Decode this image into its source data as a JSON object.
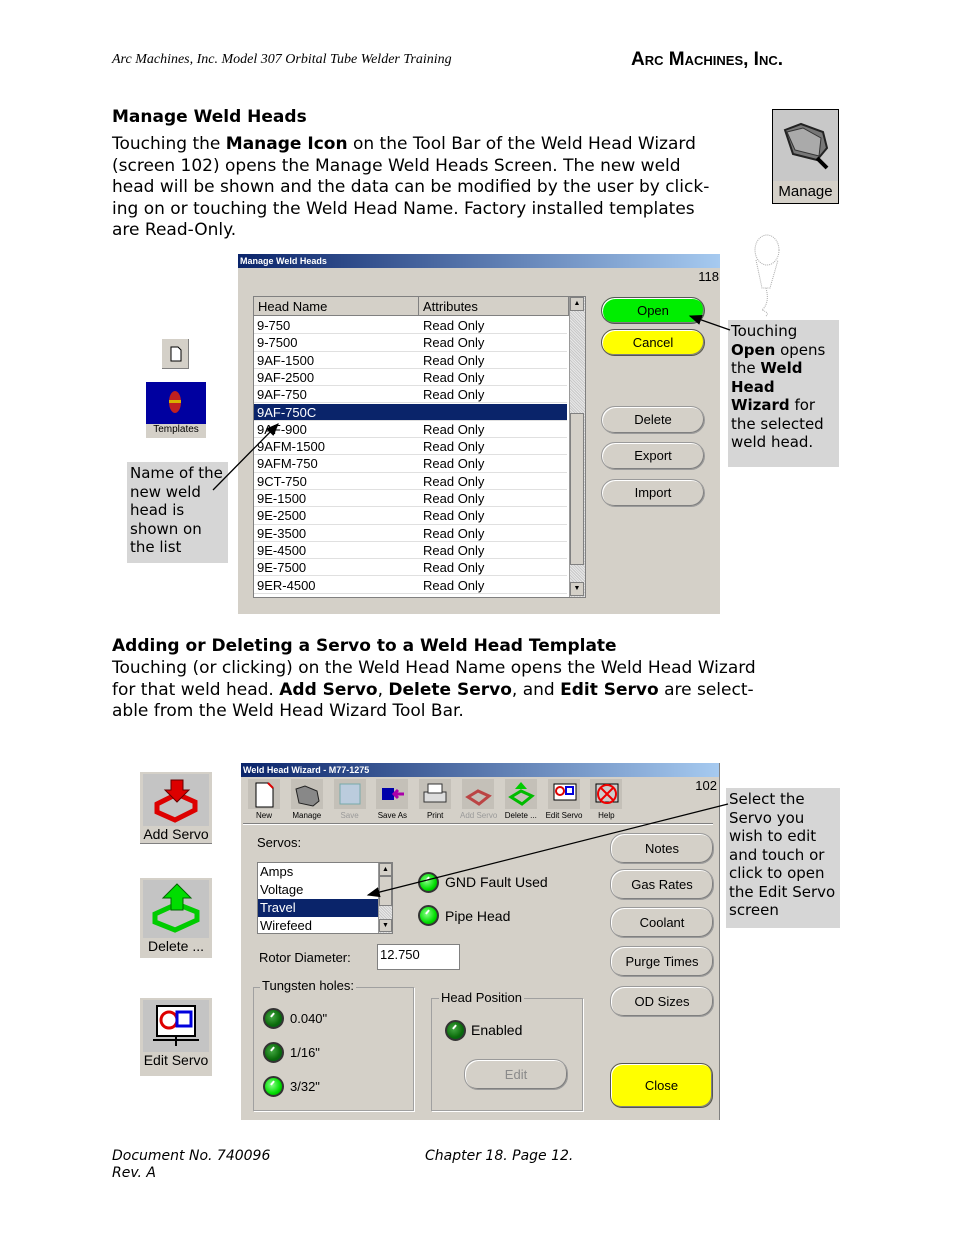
{
  "header": {
    "left": "Arc Machines, Inc. Model 307 Orbital  Tube Welder Training",
    "right": "Arc Machines, Inc."
  },
  "section1": {
    "title": "Manage Weld Heads",
    "p_pre": "Touching the ",
    "p_bold": "Manage Icon",
    "p_line1_rest": " on the Tool Bar of the Weld Head Wizard",
    "p_line2": "(screen 102) opens the Manage Weld Heads Screen. The new weld",
    "p_line3": "head will be shown and the data can be modified by the user by click-",
    "p_line4": "ing on or touching the Weld Head Name. Factory installed templates",
    "p_line5": "are Read-Only.",
    "manage_icon_label": "Manage"
  },
  "manage_dialog": {
    "title": "Manage Weld Heads",
    "screen_number": "118",
    "columns": [
      "Head Name",
      "Attributes"
    ],
    "rows": [
      {
        "name": "9-750",
        "attr": "Read Only"
      },
      {
        "name": "9-7500",
        "attr": "Read Only"
      },
      {
        "name": "9AF-1500",
        "attr": "Read Only"
      },
      {
        "name": "9AF-2500",
        "attr": "Read Only"
      },
      {
        "name": "9AF-750",
        "attr": "Read Only"
      },
      {
        "name": "9AF-750C",
        "attr": ""
      },
      {
        "name": "9AF-900",
        "attr": "Read Only"
      },
      {
        "name": "9AFM-1500",
        "attr": "Read Only"
      },
      {
        "name": "9AFM-750",
        "attr": "Read Only"
      },
      {
        "name": "9CT-750",
        "attr": "Read Only"
      },
      {
        "name": "9E-1500",
        "attr": "Read Only"
      },
      {
        "name": "9E-2500",
        "attr": "Read Only"
      },
      {
        "name": "9E-3500",
        "attr": "Read Only"
      },
      {
        "name": "9E-4500",
        "attr": "Read Only"
      },
      {
        "name": "9E-7500",
        "attr": "Read Only"
      },
      {
        "name": "9ER-4500",
        "attr": "Read Only"
      }
    ],
    "selected_row": "9AF-750C",
    "buttons": {
      "open": "Open",
      "cancel": "Cancel",
      "delete": "Delete",
      "export": "Export",
      "import": "Import"
    },
    "colors": {
      "open": "#00ee00",
      "cancel": "#ffff00",
      "selection": "#0a246a"
    }
  },
  "left_icons1": {
    "templates_label": "Templates"
  },
  "callouts": {
    "name_of_new": "Name of the new weld head is shown on the list",
    "open": {
      "t1": "Touching ",
      "b1": "Open",
      "t2": " opens the ",
      "b2": "Weld Head Wizard",
      "t3": " for the selected weld head."
    },
    "edit_servo": "Select the Servo you wish to edit and touch or click to open the Edit Servo screen"
  },
  "section2": {
    "title": "Adding or Deleting a Servo to a Weld Head Template",
    "line1": "Touching (or clicking) on the Weld Head Name opens the Weld Head Wizard",
    "line2_pre": "for that weld head. ",
    "b_add": "Add Servo",
    "sep1": ", ",
    "b_delete": "Delete Servo",
    "sep2": ", and ",
    "b_edit": "Edit Servo",
    "line2_rest": " are select-",
    "line3": "able from the Weld Head Wizard Tool Bar."
  },
  "side_icons2": {
    "add_servo": "Add Servo",
    "delete": "Delete ...",
    "edit_servo": "Edit Servo"
  },
  "wizard": {
    "title": "Weld Head Wizard - M77-1275",
    "screen_number": "102",
    "toolbar": [
      {
        "label": "New",
        "icon": "new-document-icon",
        "enabled": true
      },
      {
        "label": "Manage",
        "icon": "folder-icon",
        "enabled": true
      },
      {
        "label": "Save",
        "icon": "save-icon",
        "enabled": false
      },
      {
        "label": "Save As",
        "icon": "save-as-icon",
        "enabled": true
      },
      {
        "label": "Print",
        "icon": "printer-icon",
        "enabled": true
      },
      {
        "label": "Add Servo",
        "icon": "add-servo-icon",
        "enabled": false
      },
      {
        "label": "Delete ...",
        "icon": "delete-servo-icon",
        "enabled": true
      },
      {
        "label": "Edit Servo",
        "icon": "edit-servo-icon",
        "enabled": true
      },
      {
        "label": "Help",
        "icon": "help-icon",
        "enabled": true
      }
    ],
    "servos_label": "Servos:",
    "servos": [
      "Amps",
      "Voltage",
      "Travel",
      "Wirefeed"
    ],
    "selected_servo": "Travel",
    "gnd_fault_label": "GND Fault Used",
    "pipe_head_label": "Pipe Head",
    "rotor_label": "Rotor Diameter:",
    "rotor_value": "12.750",
    "tungsten_title": "Tungsten holes:",
    "tungsten": [
      {
        "label": "0.040\"",
        "on": false
      },
      {
        "label": "1/16\"",
        "on": false
      },
      {
        "label": "3/32\"",
        "on": true
      }
    ],
    "head_position_title": "Head Position",
    "enabled_label": "Enabled",
    "edit_label": "Edit",
    "buttons": [
      "Notes",
      "Gas Rates",
      "Coolant",
      "Purge Times",
      "OD Sizes"
    ],
    "close_label": "Close",
    "close_color": "#ffff00"
  },
  "footer": {
    "doc_no": "Document No. 740096",
    "rev": "Rev. A",
    "chapter": "Chapter 18. Page 12."
  }
}
